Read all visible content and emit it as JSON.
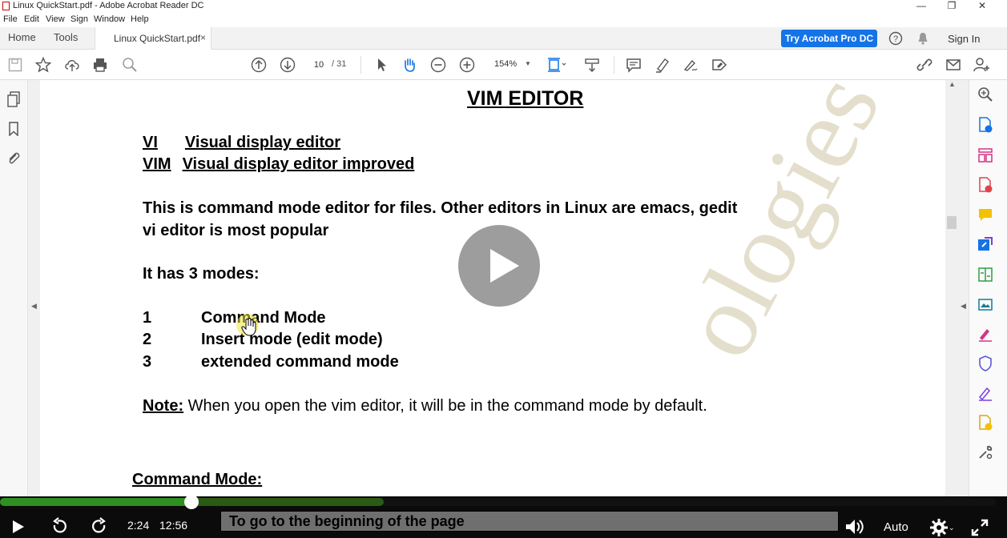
{
  "window": {
    "title": "Linux QuickStart.pdf - Adobe Acrobat Reader DC",
    "minimize": "—",
    "restore": "❐",
    "close": "✕"
  },
  "menu": [
    "File",
    "Edit",
    "View",
    "Sign",
    "Window",
    "Help"
  ],
  "tabs": {
    "home": "Home",
    "tools": "Tools",
    "document": "Linux QuickStart.pdf",
    "close": "×"
  },
  "header": {
    "try_button": "Try Acrobat Pro DC",
    "sign_in": "Sign In"
  },
  "toolbar": {
    "page_current": "10",
    "page_total": "/ 31",
    "zoom": "154%"
  },
  "document": {
    "heading": "VIM EDITOR",
    "vi_abbr": "VI",
    "vi_desc": "Visual display editor",
    "vim_abbr": "VIM",
    "vim_desc": "Visual display editor improved",
    "para1_line1": "This is command mode editor for files. Other editors in Linux are emacs, gedit",
    "para1_line2": "vi editor is most popular",
    "modes_intro": "It has 3 modes:",
    "modes": [
      {
        "num": "1",
        "label": "Command Mode"
      },
      {
        "num": "2",
        "label": "Insert mode (edit mode)"
      },
      {
        "num": "3",
        "label": "extended command mode"
      }
    ],
    "note_label": "Note:",
    "note_text": " When you open the vim editor, it will be in the command mode by default.",
    "section2": "Command Mode:",
    "watermark": "ologies"
  },
  "video": {
    "current_time": "2:24",
    "total_time": "12:56",
    "caption": "To go to the beginning of the page",
    "quality": "Auto",
    "progress_played": 0.192,
    "progress_buffered": 0.385
  },
  "colors": {
    "accent": "#1473e6",
    "progress_played": "#2f8f20",
    "progress_buffered": "#2a5a14"
  }
}
